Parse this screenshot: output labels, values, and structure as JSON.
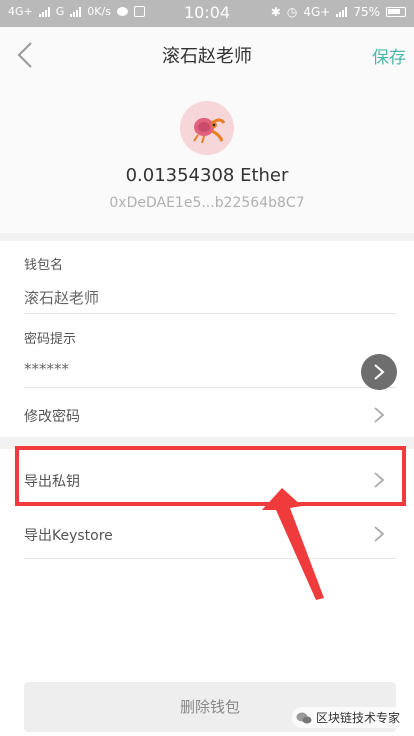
{
  "status_bar": {
    "left_network_1": "4G+",
    "left_network_2": "G",
    "speed": "0K/s",
    "time": "10:04",
    "right_network": "4G+",
    "battery": "75%"
  },
  "header": {
    "title": "滚石赵老师",
    "save_label": "保存"
  },
  "wallet": {
    "balance": "0.01354308 Ether",
    "address": "0xDeDAE1e5...b22564b8C7"
  },
  "form": {
    "name_label": "钱包名",
    "name_value": "滚石赵老师",
    "hint_label": "密码提示",
    "hint_value": "******"
  },
  "menu": {
    "change_password": "修改密码",
    "export_private_key": "导出私钥",
    "export_keystore": "导出Keystore"
  },
  "delete_label": "删除钱包",
  "watermark_text": "区块链技术专家",
  "colors": {
    "accent": "#4db6ac",
    "highlight": "#ef3b3b",
    "status_bar": "#b9b9b9"
  }
}
